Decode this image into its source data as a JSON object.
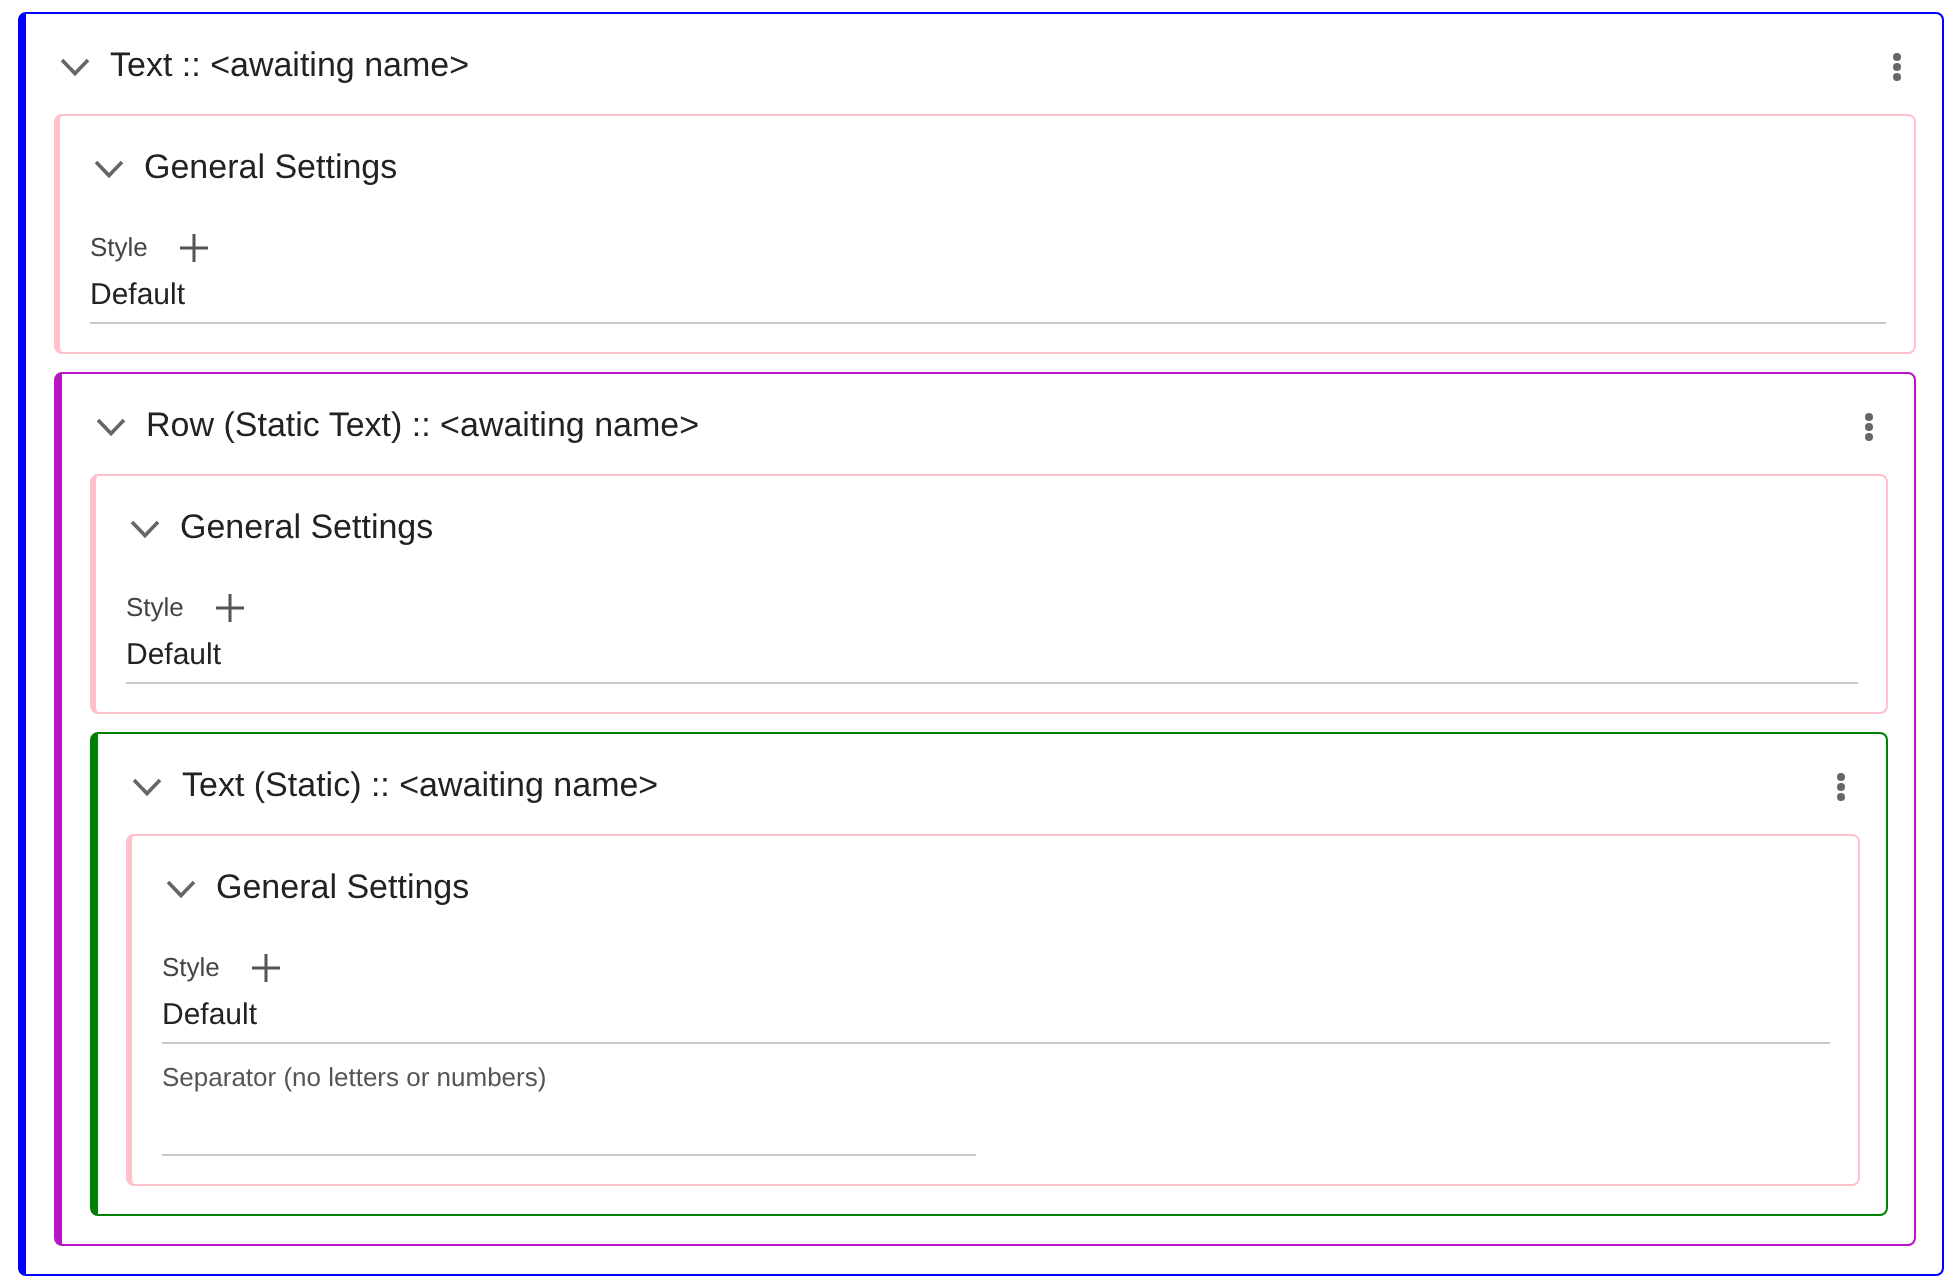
{
  "panel": {
    "kind": "component",
    "title": "Text :: <awaiting name>",
    "color": "#0000ff",
    "expanded": true,
    "children": [
      {
        "kind": "settings",
        "title": "General Settings",
        "expanded": true,
        "fields": [
          {
            "kind": "style",
            "label": "Style",
            "value": "Default"
          }
        ]
      },
      {
        "kind": "component",
        "title": "Row (Static Text) :: <awaiting name>",
        "color": "#ba14c8",
        "expanded": true,
        "children": [
          {
            "kind": "settings",
            "title": "General Settings",
            "expanded": true,
            "fields": [
              {
                "kind": "style",
                "label": "Style",
                "value": "Default"
              }
            ]
          },
          {
            "kind": "component",
            "title": "Text (Static) :: <awaiting name>",
            "color": "#008000",
            "expanded": true,
            "children": [
              {
                "kind": "settings",
                "title": "General Settings",
                "expanded": true,
                "fields": [
                  {
                    "kind": "style",
                    "label": "Style",
                    "value": "Default"
                  },
                  {
                    "kind": "text",
                    "label": "Separator (no letters or numbers)"
                  }
                ]
              }
            ]
          }
        ]
      }
    ]
  }
}
